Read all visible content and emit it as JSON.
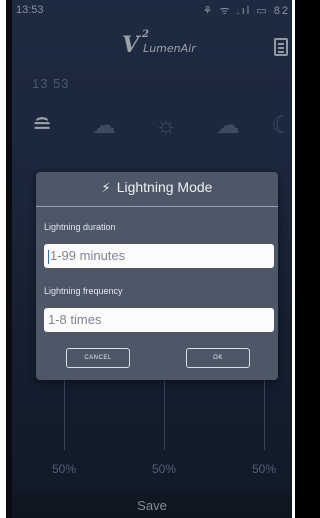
{
  "status_bar": {
    "time": "13:53",
    "icons": "⚘ ᯤ .ıl ▭ 82"
  },
  "header": {
    "logo_main": "V",
    "logo_sup": "2",
    "logo_sub": "LumenAir"
  },
  "background": {
    "clock": "13 53",
    "percents": [
      "50%",
      "50%",
      "50%"
    ],
    "save_label": "Save"
  },
  "dialog": {
    "title": "Lightning Mode",
    "duration_label": "Lightning duration",
    "duration_placeholder": "1-99 minutes",
    "frequency_label": "Lightning frequency",
    "frequency_placeholder": "1-8 times",
    "cancel_label": "CANCEL",
    "ok_label": "OK"
  }
}
